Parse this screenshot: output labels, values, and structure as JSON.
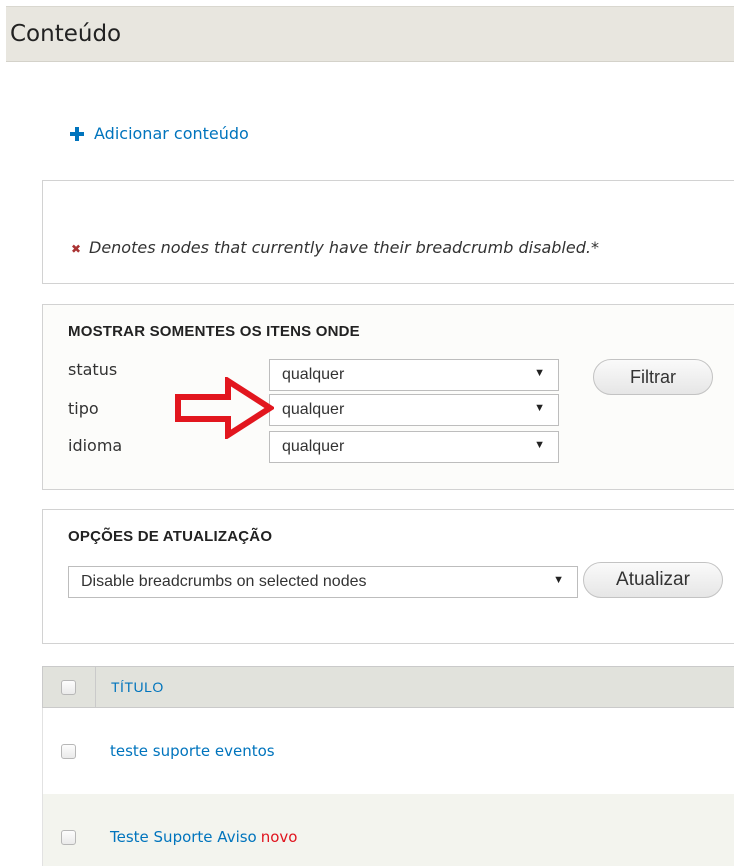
{
  "page": {
    "title": "Conteúdo"
  },
  "actions": {
    "add_content": "Adicionar conteúdo"
  },
  "notice": {
    "text": "Denotes nodes that currently have their breadcrumb disabled.*"
  },
  "filter": {
    "title": "MOSTRAR SOMENTES OS ITENS ONDE",
    "rows": [
      {
        "label": "status",
        "value": "qualquer"
      },
      {
        "label": "tipo",
        "value": "qualquer"
      },
      {
        "label": "idioma",
        "value": "qualquer"
      }
    ],
    "button": "Filtrar"
  },
  "update": {
    "title": "OPÇÕES DE ATUALIZAÇÃO",
    "action_value": "Disable breadcrumbs on selected nodes",
    "button": "Atualizar"
  },
  "table": {
    "header": "TÍTULO",
    "rows": [
      {
        "title": "teste suporte eventos",
        "badge": ""
      },
      {
        "title": "Teste Suporte Aviso",
        "badge": "novo"
      }
    ]
  },
  "colors": {
    "link": "#0074bd",
    "badge": "#e0141e",
    "annotation_arrow": "#e2161e"
  },
  "icons": {
    "add": "plus-icon",
    "dropdown": "caret-down-icon",
    "annotation": "arrow-right-icon"
  }
}
